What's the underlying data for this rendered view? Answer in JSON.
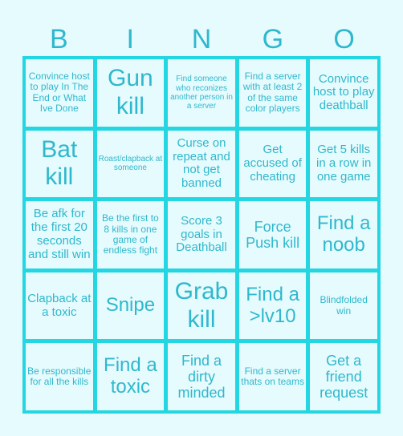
{
  "header": {
    "letters": [
      "B",
      "I",
      "N",
      "G",
      "O"
    ]
  },
  "board": {
    "rows": [
      [
        "Convince host to play In The End or What Ive Done",
        "Gun kill",
        "Find someone who reconizes another person in a server",
        "Find a server with at least 2 of the same color players",
        "Convince host to play deathball"
      ],
      [
        "Bat kill",
        "Roast/clapback at someone",
        "Curse on repeat and not get banned",
        "Get accused of cheating",
        "Get 5 kills in a row in one game"
      ],
      [
        "Be afk for the first 20 seconds and still win",
        "Be the first to 8 kills in one game of endless fight",
        "Score 3 goals in Deathball",
        "Force Push kill",
        "Find a noob"
      ],
      [
        "Clapback at a toxic",
        "Snipe",
        "Grab kill",
        "Find a >lv10",
        "Blindfolded win"
      ],
      [
        "Be responsible for all the kills",
        "Find a toxic",
        "Find a dirty minded",
        "Find a server thats on teams",
        "Get a friend request"
      ]
    ]
  },
  "colors": {
    "background": "#e6fbfe",
    "grid_border": "#23d6e2",
    "text": "#2fb8cc"
  }
}
